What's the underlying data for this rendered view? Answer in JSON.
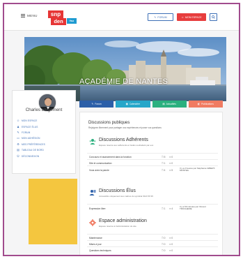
{
  "header": {
    "menu_label": "MENU",
    "logo": {
      "line1": "snp",
      "line2": "den",
      "line3": "fsu"
    },
    "forum_label": "FORUM",
    "espace_label": "MON ESPACE",
    "search_icon": "search-icon"
  },
  "banner": {
    "title": "ACADÉMIE DE NANTES"
  },
  "profile": {
    "name": "Charles Largement",
    "nav": [
      {
        "icon": "user-icon",
        "glyph": "☺",
        "label": "MON ESPACE"
      },
      {
        "icon": "users-icon",
        "glyph": "♟",
        "label": "ESPACE ÉLUS"
      },
      {
        "icon": "chat-icon",
        "glyph": "✎",
        "label": "FORUM"
      },
      {
        "icon": "card-icon",
        "glyph": "▭",
        "label": "MON ADHÉSION"
      },
      {
        "icon": "settings-icon",
        "glyph": "⚙",
        "label": "MES PRÉFÉRENCES"
      },
      {
        "icon": "dashboard-icon",
        "glyph": "▤",
        "label": "TABLEAU DE BORD"
      },
      {
        "icon": "logout-icon",
        "glyph": "⏻",
        "label": "DÉCONNEXION"
      }
    ]
  },
  "tabs": [
    {
      "label": "Forum",
      "glyph": "✎",
      "color": "#2c5fa8"
    },
    {
      "label": "Calendrier",
      "glyph": "▦",
      "color": "#26a6c9"
    },
    {
      "label": "Actualités",
      "glyph": "▤",
      "color": "#2bb07f"
    },
    {
      "label": "Publications",
      "glyph": "◧",
      "color": "#f07b62"
    }
  ],
  "forum": {
    "title": "Discussions publiques",
    "subtitle": "Rejoignez librement pour partager vos expériences et poser vos questions",
    "sections": [
      {
        "title": "Discussions Adhérents",
        "subtitle": "Espace réservé aux adhérents et Gélés souhaitant par eux",
        "color": "#2bb07f",
        "rows": [
          {
            "name": "Concours et avancement dans la fonction",
            "topics": "5",
            "posts": "0",
            "last": ""
          },
          {
            "name": "Site et communication",
            "topics": "1",
            "posts": "0",
            "last": ""
          },
          {
            "name": "Vous avez la parole",
            "topics": "4",
            "posts": "5",
            "last": "Il y a 2 heures par Stéphanie GIBERT-MONTEIL"
          }
        ]
      },
      {
        "title": "Discussions Élus",
        "subtitle": "Accessible uniquement aux cadres du syndicat SDA 56 S5",
        "color": "#2c5fa8",
        "rows": [
          {
            "name": "Expression libre",
            "topics": "1",
            "posts": "4",
            "last": "Il y a 50 minutes par Vincent TROCHERIE"
          }
        ]
      },
      {
        "title": "Espace administration",
        "subtitle": "Espace réservé à l'administration du site",
        "color": "#f07b62",
        "rows": [
          {
            "name": "Maintenance",
            "topics": "0",
            "posts": "0",
            "last": ""
          },
          {
            "name": "Mises à jour",
            "topics": "0",
            "posts": "0",
            "last": ""
          },
          {
            "name": "Questions techniques",
            "topics": "0",
            "posts": "0",
            "last": ""
          }
        ]
      }
    ]
  }
}
